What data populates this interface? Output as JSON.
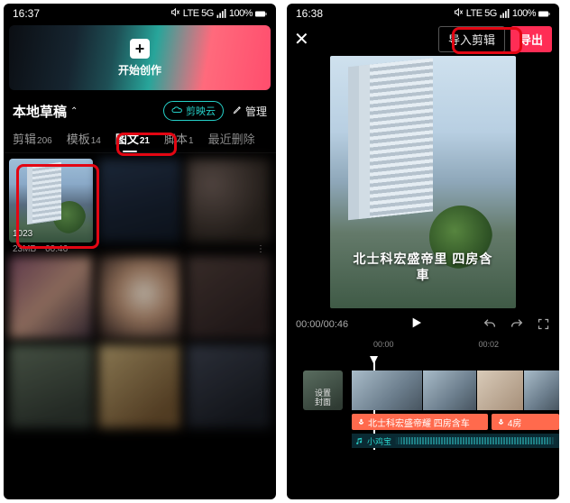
{
  "left": {
    "status": {
      "time": "16:37",
      "net": "LTE 5G",
      "battery": "100%"
    },
    "hero": {
      "label": "开始创作"
    },
    "drafts_title": "本地草稿",
    "cloud_label": "剪映云",
    "manage_label": "管理",
    "tabs": [
      {
        "label": "剪辑",
        "count": "206"
      },
      {
        "label": "模板",
        "count": "14"
      },
      {
        "label": "图文",
        "count": "21"
      },
      {
        "label": "脚本",
        "count": "1"
      },
      {
        "label": "最近删除",
        "count": ""
      }
    ],
    "first_thumb_badge": "1023",
    "meta": {
      "size": "23MB",
      "duration": "00:46"
    }
  },
  "right": {
    "status": {
      "time": "16:38",
      "net": "LTE 5G",
      "battery": "100%"
    },
    "import_label": "导入剪辑",
    "export_label": "导出",
    "caption_line1": "北士科宏盛帝里 四房含",
    "caption_line2": "車",
    "tc_current": "00:00",
    "tc_total": "00:46",
    "ruler": [
      "00:00",
      "00:02"
    ],
    "cover_label1": "设置",
    "cover_label2": "封面",
    "audio1": "北士科宏盛帝耀 四房含车",
    "audio2": "4房",
    "music": "小鸡宝"
  }
}
